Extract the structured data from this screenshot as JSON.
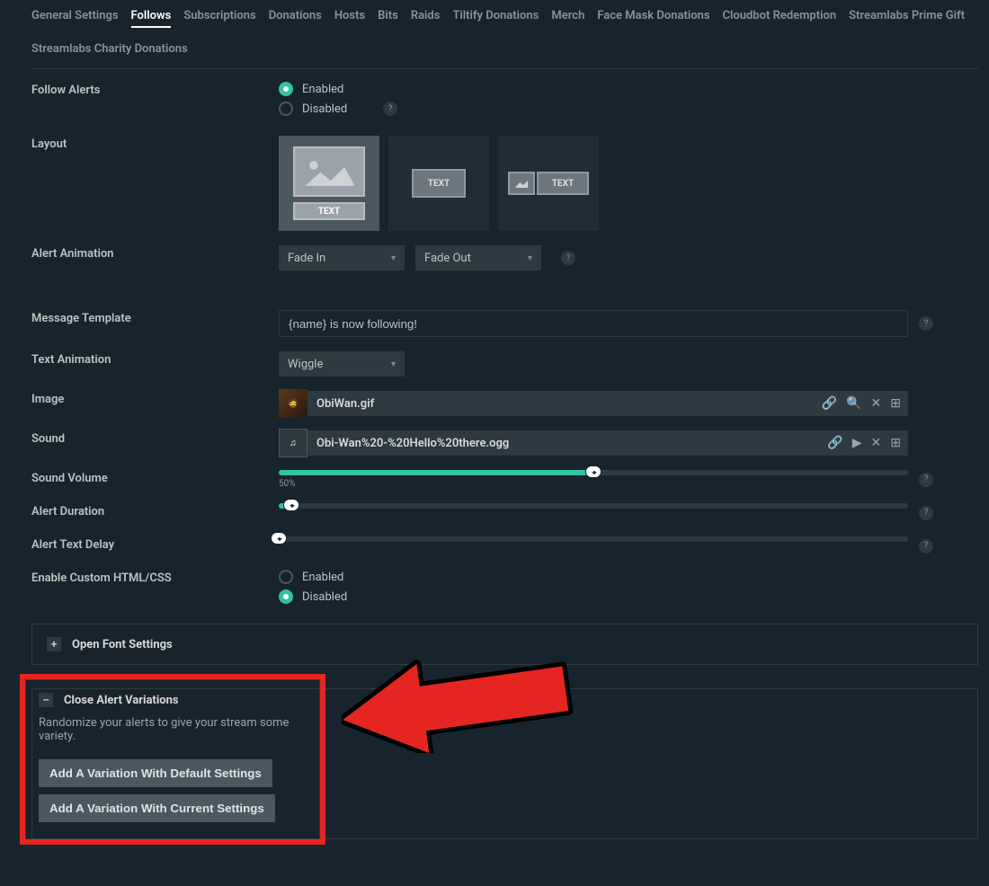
{
  "tabs": [
    "General Settings",
    "Follows",
    "Subscriptions",
    "Donations",
    "Hosts",
    "Bits",
    "Raids",
    "Tiltify Donations",
    "Merch",
    "Face Mask Donations",
    "Cloudbot Redemption",
    "Streamlabs Prime Gift",
    "Streamlabs Charity Donations"
  ],
  "active_tab": "Follows",
  "follow_alerts": {
    "label": "Follow Alerts",
    "enabled_label": "Enabled",
    "disabled_label": "Disabled",
    "value": "enabled"
  },
  "layout": {
    "label": "Layout",
    "text_badge": "TEXT",
    "selected": 0
  },
  "alert_animation": {
    "label": "Alert Animation",
    "in": "Fade In",
    "out": "Fade Out"
  },
  "message_template": {
    "label": "Message Template",
    "value": "{name} is now following!"
  },
  "text_animation": {
    "label": "Text Animation",
    "value": "Wiggle"
  },
  "image": {
    "label": "Image",
    "file": "ObiWan.gif"
  },
  "sound": {
    "label": "Sound",
    "file": "Obi-Wan%20-%20Hello%20there.ogg"
  },
  "sound_volume": {
    "label": "Sound Volume",
    "value": 50,
    "display": "50%"
  },
  "alert_duration": {
    "label": "Alert Duration",
    "value": 8,
    "display": "8s",
    "pct": 2
  },
  "alert_text_delay": {
    "label": "Alert Text Delay",
    "value": 0,
    "display": "0s",
    "pct": 0
  },
  "custom_html": {
    "label": "Enable Custom HTML/CSS",
    "enabled_label": "Enabled",
    "disabled_label": "Disabled",
    "value": "disabled"
  },
  "font_panel": {
    "title": "Open Font Settings",
    "icon": "+"
  },
  "variations_panel": {
    "title": "Close Alert Variations",
    "icon": "–",
    "desc": "Randomize your alerts to give your stream some variety.",
    "btn_default": "Add A Variation With Default Settings",
    "btn_current": "Add A Variation With Current Settings"
  }
}
